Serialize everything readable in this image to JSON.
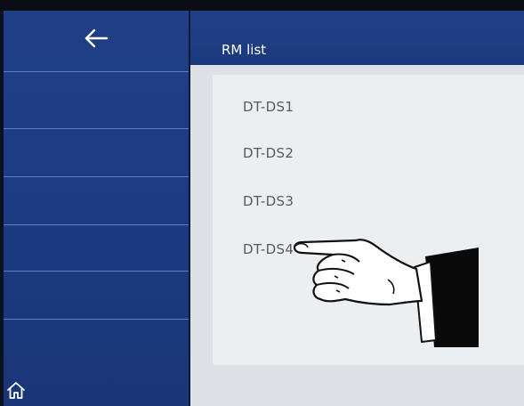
{
  "sidebar": {
    "back_icon": "arrow-left-icon",
    "home_icon": "home-icon"
  },
  "header": {
    "title": "RM list"
  },
  "rm_list": {
    "items": [
      {
        "label": "DT-DS1"
      },
      {
        "label": "DT-DS2"
      },
      {
        "label": "DT-DS3"
      },
      {
        "label": "DT-DS4"
      }
    ]
  },
  "colors": {
    "sidebar_blue": "#1f3f87",
    "header_blue": "#203f86",
    "list_background": "#eceff1",
    "list_text": "#555a60"
  }
}
